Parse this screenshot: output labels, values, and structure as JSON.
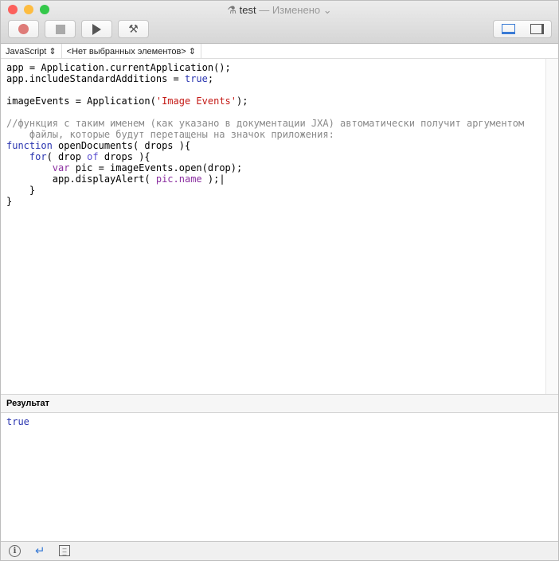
{
  "window": {
    "title": "test",
    "status": "— Изменено"
  },
  "navbar": {
    "language": "JavaScript",
    "element": "<Нет выбранных элементов>"
  },
  "editor": {
    "lines": [
      [
        {
          "t": "app = Application.currentApplication();",
          "c": "#000"
        }
      ],
      [
        {
          "t": "app.includeStandardAdditions = ",
          "c": "#000"
        },
        {
          "t": "true",
          "c": "#2a35b0"
        },
        {
          "t": ";",
          "c": "#000"
        }
      ],
      [],
      [
        {
          "t": "imageEvents = Application(",
          "c": "#000"
        },
        {
          "t": "'Image Events'",
          "c": "#c41a16"
        },
        {
          "t": ");",
          "c": "#000"
        }
      ],
      [],
      [
        {
          "t": "//функция с таким именем (как указано в документации JXA) автоматически получит аргументом",
          "c": "#8a8a8a"
        }
      ],
      [
        {
          "t": "    файлы, которые будут перетащены на значок приложения:",
          "c": "#8a8a8a"
        }
      ],
      [
        {
          "t": "function",
          "c": "#2a35b0"
        },
        {
          "t": " openDocuments( drops ){",
          "c": "#000"
        }
      ],
      [
        {
          "t": "    ",
          "c": "#000"
        },
        {
          "t": "for",
          "c": "#2a35b0"
        },
        {
          "t": "( drop ",
          "c": "#000"
        },
        {
          "t": "of",
          "c": "#5b4fd0"
        },
        {
          "t": " drops ){",
          "c": "#000"
        }
      ],
      [
        {
          "t": "        ",
          "c": "#000"
        },
        {
          "t": "var",
          "c": "#8b2fa0"
        },
        {
          "t": " pic = imageEvents.open(drop);",
          "c": "#000"
        }
      ],
      [
        {
          "t": "        app.displayAlert( ",
          "c": "#000"
        },
        {
          "t": "pic.name",
          "c": "#8b2fa0"
        },
        {
          "t": " );|",
          "c": "#000"
        }
      ],
      [
        {
          "t": "    }",
          "c": "#000"
        }
      ],
      [
        {
          "t": "}",
          "c": "#000"
        }
      ]
    ]
  },
  "result_panel": {
    "header": "Результат",
    "value": "true"
  }
}
